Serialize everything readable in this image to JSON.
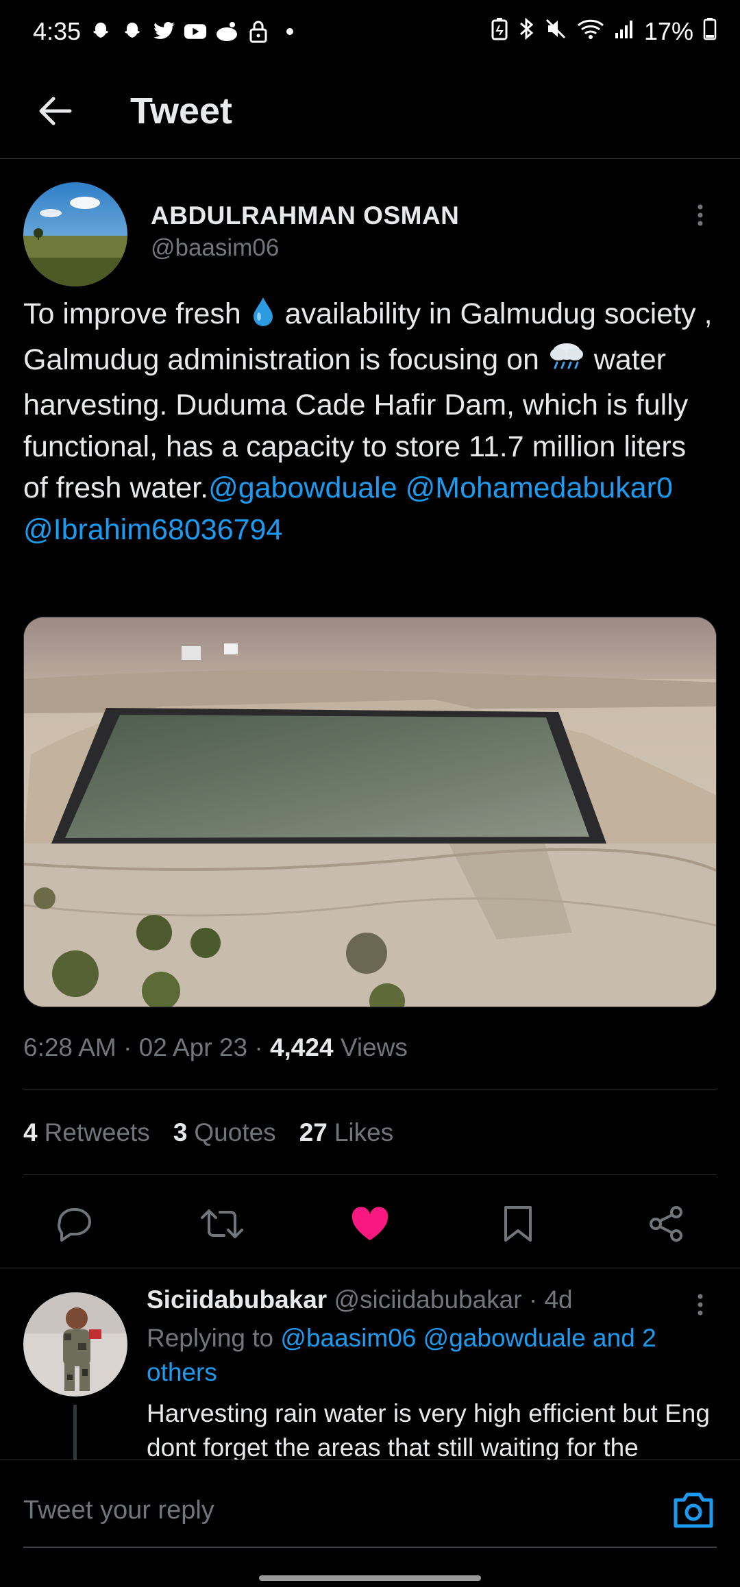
{
  "status_bar": {
    "time": "4:35",
    "battery": "17%"
  },
  "header": {
    "title": "Tweet"
  },
  "tweet": {
    "author_name": "ABDULRAHMAN OSMAN",
    "author_handle": "@baasim06",
    "text_part1": "To improve fresh ",
    "text_part2": " availability in Galmudug society , Galmudug administration is focusing on ",
    "text_part3": " water harvesting. Duduma Cade Hafir Dam, which is fully functional, has a capacity to store 11.7 million liters of fresh water.",
    "mention1": "@gabowduale",
    "mention2": "@Mohamedabukar0",
    "mention3": "@Ibrahim68036794",
    "time": "6:28 AM",
    "date": "02 Apr 23",
    "views_count": "4,424",
    "views_label": "Views",
    "retweets_count": "4",
    "retweets_label": "Retweets",
    "quotes_count": "3",
    "quotes_label": "Quotes",
    "likes_count": "27",
    "likes_label": "Likes",
    "liked": true
  },
  "reply": {
    "name": "Siciidabubakar",
    "handle": "@siciidabubakar",
    "age": "4d",
    "replying_label": "Replying to",
    "replying_to": "@baasim06 @gabowduale and 2 others",
    "text": "Harvesting rain water is very high efficient but Eng dont forget the areas that still waiting for the"
  },
  "composer": {
    "placeholder": "Tweet your reply"
  },
  "colors": {
    "accent": "#1d9bf0",
    "like": "#f91880",
    "background": "#000000"
  },
  "icons": [
    "back-arrow-icon",
    "more-icon",
    "reply-icon",
    "retweet-icon",
    "heart-icon",
    "bookmark-icon",
    "share-icon",
    "camera-icon"
  ]
}
